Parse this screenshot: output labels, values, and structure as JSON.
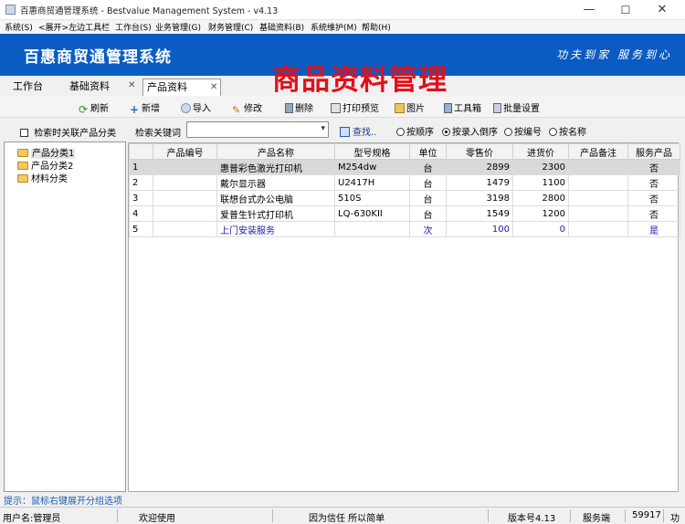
{
  "window": {
    "title": "百惠商贸通管理系统 - Bestvalue Management System - v4.13",
    "minimize": "—",
    "maximize": "☐",
    "close": "✕"
  },
  "menu": [
    "系统(S)",
    "<展开>左边工具栏",
    "工作台(S)",
    "业务管理(G)",
    "财务管理(C)",
    "基础资料(B)",
    "系统维护(M)",
    "帮助(H)"
  ],
  "banner": {
    "title": "百惠商贸通管理系统",
    "slogan": "功夫到家 服务到心",
    "color": "#0a5cc3"
  },
  "tabs": [
    {
      "label": "工作台"
    },
    {
      "label": "基础资料"
    },
    {
      "label": "产品资料"
    }
  ],
  "overlay_title": "商品资料管理",
  "toolbar": {
    "refresh": "刷新",
    "add": "新增",
    "import": "导入",
    "edit": "修改",
    "delete": "删除",
    "print_preview": "打印预览",
    "image": "图片",
    "toolbox": "工具箱",
    "batch_settings": "批量设置"
  },
  "left": {
    "checkbox_label": "检索时关联产品分类",
    "tree": [
      "产品分类1",
      "产品分类2",
      "材料分类"
    ],
    "hint": "提示：鼠标右键展开分组选项"
  },
  "search": {
    "label": "检索关键词",
    "value": "",
    "find_button": "查找..",
    "sort_options": [
      "按顺序",
      "按录入倒序",
      "按编号",
      "按名称"
    ],
    "selected_sort": "按录入倒序"
  },
  "table": {
    "columns": [
      "",
      "产品编号",
      "产品名称",
      "型号规格",
      "单位",
      "零售价",
      "进货价",
      "产品备注",
      "服务产品"
    ],
    "rows": [
      [
        "1",
        "",
        "惠普彩色激光打印机",
        "M254dw",
        "台",
        "2899",
        "2300",
        "",
        "否"
      ],
      [
        "2",
        "",
        "戴尔显示器",
        "U2417H",
        "台",
        "1479",
        "1100",
        "",
        "否"
      ],
      [
        "3",
        "",
        "联想台式办公电脑",
        "510S",
        "台",
        "3198",
        "2800",
        "",
        "否"
      ],
      [
        "4",
        "",
        "爱普生针式打印机",
        "LQ-630KII",
        "台",
        "1549",
        "1200",
        "",
        "否"
      ],
      [
        "5",
        "",
        "上门安装服务",
        "",
        "次",
        "100",
        "0",
        "",
        "是"
      ]
    ]
  },
  "status": {
    "user": "用户名:管理员",
    "welcome": "欢迎使用",
    "motto": "因为信任 所以简单",
    "version": "版本号4.13",
    "server": "服务端",
    "port": "59917",
    "extra": "功"
  }
}
